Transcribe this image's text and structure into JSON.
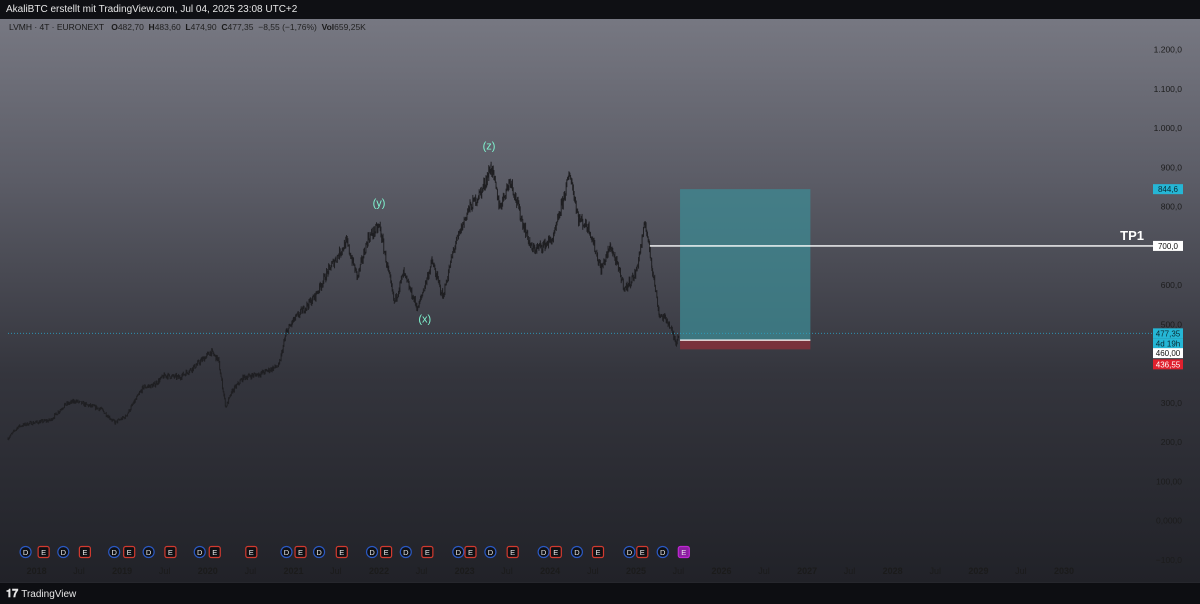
{
  "header": {
    "caption": "AkaliBTC erstellt mit TradingView.com, Jul 04, 2025 23:08 UTC+2"
  },
  "legend": {
    "symbol": "LVMH · 4T · EURONEXT",
    "o_label": "O",
    "o_value": "482,70",
    "h_label": "H",
    "h_value": "483,60",
    "l_label": "L",
    "l_value": "474,90",
    "c_label": "C",
    "c_value": "477,35",
    "change": "−8,55 (−1,76%)",
    "vol_label": "Vol",
    "vol_value": "659,25K"
  },
  "footer": {
    "brand": "TradingView",
    "brand_icon": "tradingview-logo-icon"
  },
  "colors": {
    "target_zone": "#3d8a93",
    "stop_zone": "#8a2f3b",
    "tp_line": "#ffffff",
    "price_badge": "#25b6d5",
    "stop_badge": "#e0202d"
  },
  "chart_data": {
    "type": "candlestick",
    "y_axis": {
      "scale": "linear",
      "range": [
        -100,
        1250
      ],
      "ticks": [
        {
          "v": 1200,
          "label": "1.200,0"
        },
        {
          "v": 1100,
          "label": "1.100,0"
        },
        {
          "v": 1000,
          "label": "1.000,0"
        },
        {
          "v": 900,
          "label": "900,0"
        },
        {
          "v": 800,
          "label": "800,0"
        },
        {
          "v": 700,
          "label": "700,0"
        },
        {
          "v": 600,
          "label": "600,0"
        },
        {
          "v": 500,
          "label": "500,0"
        },
        {
          "v": 400,
          "label": "400,0"
        },
        {
          "v": 300,
          "label": "300,0"
        },
        {
          "v": 200,
          "label": "200,0"
        },
        {
          "v": 100,
          "label": "100,00"
        },
        {
          "v": 0,
          "label": "0,0000"
        },
        {
          "v": -100,
          "label": "−100,0"
        }
      ]
    },
    "x_axis": {
      "range": [
        "2017-09-01",
        "2030-10-01"
      ],
      "ticks": [
        {
          "t": "2018-01-01",
          "label": "2018",
          "year": true
        },
        {
          "t": "2018-07-01",
          "label": "Jul",
          "year": false
        },
        {
          "t": "2019-01-01",
          "label": "2019",
          "year": true
        },
        {
          "t": "2019-07-01",
          "label": "Jul",
          "year": false
        },
        {
          "t": "2020-01-01",
          "label": "2020",
          "year": true
        },
        {
          "t": "2020-07-01",
          "label": "Jul",
          "year": false
        },
        {
          "t": "2021-01-01",
          "label": "2021",
          "year": true
        },
        {
          "t": "2021-07-01",
          "label": "Jul",
          "year": false
        },
        {
          "t": "2022-01-01",
          "label": "2022",
          "year": true
        },
        {
          "t": "2022-07-01",
          "label": "Jul",
          "year": false
        },
        {
          "t": "2023-01-01",
          "label": "2023",
          "year": true
        },
        {
          "t": "2023-07-01",
          "label": "Jul",
          "year": false
        },
        {
          "t": "2024-01-01",
          "label": "2024",
          "year": true
        },
        {
          "t": "2024-07-01",
          "label": "Jul",
          "year": false
        },
        {
          "t": "2025-01-01",
          "label": "2025",
          "year": true
        },
        {
          "t": "2025-07-01",
          "label": "Jul",
          "year": false
        },
        {
          "t": "2026-01-01",
          "label": "2026",
          "year": true
        },
        {
          "t": "2026-07-01",
          "label": "Jul",
          "year": false
        },
        {
          "t": "2027-01-01",
          "label": "2027",
          "year": true
        },
        {
          "t": "2027-07-01",
          "label": "Jul",
          "year": false
        },
        {
          "t": "2028-01-01",
          "label": "2028",
          "year": true
        },
        {
          "t": "2028-07-01",
          "label": "Jul",
          "year": false
        },
        {
          "t": "2029-01-01",
          "label": "2029",
          "year": true
        },
        {
          "t": "2029-07-01",
          "label": "Jul",
          "year": false
        },
        {
          "t": "2030-01-01",
          "label": "2030",
          "year": true
        }
      ]
    },
    "price_series": [
      [
        "2017-09-01",
        210
      ],
      [
        "2017-10-15",
        240
      ],
      [
        "2017-12-01",
        248
      ],
      [
        "2018-03-01",
        256
      ],
      [
        "2018-05-01",
        295
      ],
      [
        "2018-06-15",
        305
      ],
      [
        "2018-08-01",
        295
      ],
      [
        "2018-10-01",
        285
      ],
      [
        "2018-12-01",
        250
      ],
      [
        "2019-01-15",
        265
      ],
      [
        "2019-04-01",
        340
      ],
      [
        "2019-05-15",
        345
      ],
      [
        "2019-07-01",
        370
      ],
      [
        "2019-09-01",
        365
      ],
      [
        "2019-11-01",
        390
      ],
      [
        "2020-01-15",
        430
      ],
      [
        "2020-02-15",
        410
      ],
      [
        "2020-03-18",
        290
      ],
      [
        "2020-04-15",
        330
      ],
      [
        "2020-06-01",
        365
      ],
      [
        "2020-08-15",
        375
      ],
      [
        "2020-10-31",
        395
      ],
      [
        "2020-12-01",
        480
      ],
      [
        "2021-01-01",
        510
      ],
      [
        "2021-04-01",
        570
      ],
      [
        "2021-06-01",
        640
      ],
      [
        "2021-08-15",
        710
      ],
      [
        "2021-10-01",
        620
      ],
      [
        "2021-11-15",
        720
      ],
      [
        "2022-01-03",
        750
      ],
      [
        "2022-03-07",
        555
      ],
      [
        "2022-04-15",
        630
      ],
      [
        "2022-06-15",
        540
      ],
      [
        "2022-08-15",
        660
      ],
      [
        "2022-09-30",
        570
      ],
      [
        "2022-11-15",
        690
      ],
      [
        "2023-01-15",
        790
      ],
      [
        "2023-03-15",
        840
      ],
      [
        "2023-04-24",
        902
      ],
      [
        "2023-05-31",
        800
      ],
      [
        "2023-07-15",
        870
      ],
      [
        "2023-08-31",
        770
      ],
      [
        "2023-10-15",
        690
      ],
      [
        "2023-12-01",
        700
      ],
      [
        "2024-01-15",
        720
      ],
      [
        "2024-03-25",
        886
      ],
      [
        "2024-05-01",
        770
      ],
      [
        "2024-06-15",
        745
      ],
      [
        "2024-08-05",
        640
      ],
      [
        "2024-09-15",
        700
      ],
      [
        "2024-11-15",
        590
      ],
      [
        "2024-12-31",
        630
      ],
      [
        "2025-02-10",
        760
      ],
      [
        "2025-03-10",
        650
      ],
      [
        "2025-04-10",
        525
      ],
      [
        "2025-05-15",
        510
      ],
      [
        "2025-06-20",
        455
      ],
      [
        "2025-07-04",
        477.35
      ]
    ],
    "wave_labels": [
      {
        "label": "(y)",
        "t": "2022-01-01",
        "v": 800
      },
      {
        "label": "(x)",
        "t": "2022-07-15",
        "v": 505
      },
      {
        "label": "(z)",
        "t": "2023-04-15",
        "v": 945
      }
    ],
    "position": {
      "type": "long",
      "start": "2025-07-08",
      "end": "2027-01-15",
      "entry": 460.0,
      "target": 844.6,
      "stop": 436.55,
      "stats_label": "4d 19h"
    },
    "lines": [
      {
        "label": "TP1",
        "value": 700.0,
        "start": "2025-03-01",
        "value_label": "700,0"
      }
    ],
    "current_price": {
      "value": 477.35,
      "label": "477,35"
    },
    "price_badges": [
      {
        "label": "844,6",
        "value": 844.6,
        "color": "#25b6d5"
      },
      {
        "label": "477,35",
        "value": 477.35,
        "color": "#25b6d5"
      },
      {
        "label": "4d 19h",
        "value": 477.35,
        "color": "#25b6d5"
      },
      {
        "label": "460,00",
        "value": 460.0,
        "color": "#ffffff"
      },
      {
        "label": "436,55",
        "value": 436.55,
        "color": "#e0202d"
      }
    ],
    "event_markers": [
      {
        "t": "2017-11-15",
        "kind": "D"
      },
      {
        "t": "2018-01-31",
        "kind": "E"
      },
      {
        "t": "2018-04-25",
        "kind": "D"
      },
      {
        "t": "2018-07-26",
        "kind": "E"
      },
      {
        "t": "2018-11-28",
        "kind": "D"
      },
      {
        "t": "2019-01-31",
        "kind": "E"
      },
      {
        "t": "2019-04-24",
        "kind": "D"
      },
      {
        "t": "2019-07-26",
        "kind": "E"
      },
      {
        "t": "2019-11-28",
        "kind": "D"
      },
      {
        "t": "2020-01-31",
        "kind": "E"
      },
      {
        "t": "2020-07-05",
        "kind": "E"
      },
      {
        "t": "2020-12-02",
        "kind": "D"
      },
      {
        "t": "2021-01-31",
        "kind": "E"
      },
      {
        "t": "2021-04-20",
        "kind": "D"
      },
      {
        "t": "2021-07-26",
        "kind": "E"
      },
      {
        "t": "2021-12-02",
        "kind": "D"
      },
      {
        "t": "2022-01-31",
        "kind": "E"
      },
      {
        "t": "2022-04-25",
        "kind": "D"
      },
      {
        "t": "2022-07-26",
        "kind": "E"
      },
      {
        "t": "2022-12-05",
        "kind": "D"
      },
      {
        "t": "2023-01-26",
        "kind": "E"
      },
      {
        "t": "2023-04-21",
        "kind": "D"
      },
      {
        "t": "2023-07-25",
        "kind": "E"
      },
      {
        "t": "2023-12-04",
        "kind": "D"
      },
      {
        "t": "2024-01-25",
        "kind": "E"
      },
      {
        "t": "2024-04-24",
        "kind": "D"
      },
      {
        "t": "2024-07-23",
        "kind": "E"
      },
      {
        "t": "2024-12-04",
        "kind": "D"
      },
      {
        "t": "2025-01-28",
        "kind": "E"
      },
      {
        "t": "2025-04-25",
        "kind": "D"
      },
      {
        "t": "2025-07-24",
        "kind": "E",
        "upcoming": true
      }
    ]
  }
}
